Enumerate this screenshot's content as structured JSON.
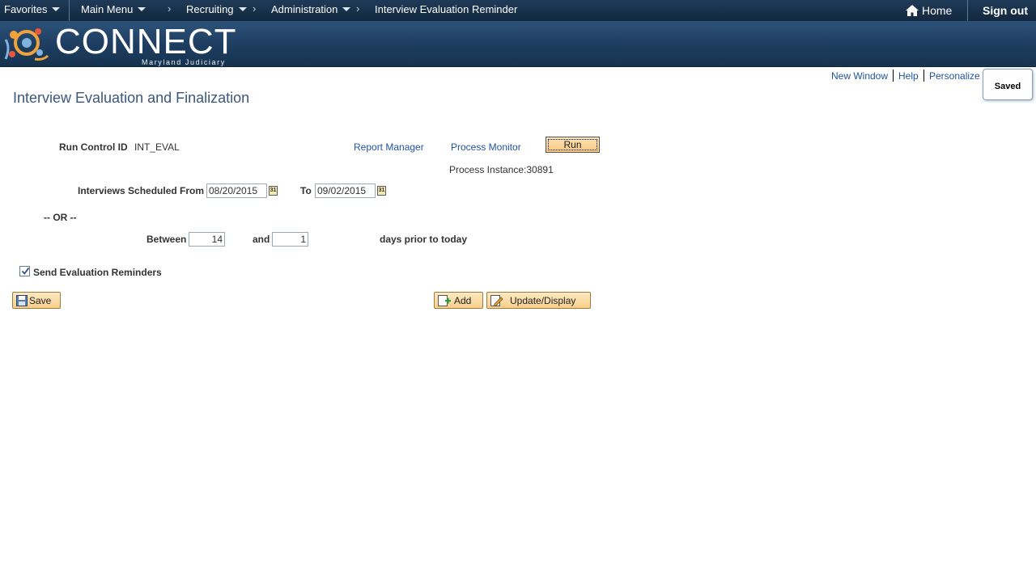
{
  "nav": {
    "favorites": "Favorites",
    "main_menu": "Main Menu",
    "breadcrumbs": [
      "Recruiting",
      "Administration",
      "Interview Evaluation Reminder"
    ],
    "home": "Home",
    "sign_out": "Sign out"
  },
  "banner": {
    "logo_text": "CONNECT",
    "logo_subtext": "Maryland Judiciary"
  },
  "page_links": {
    "new_window": "New Window",
    "help": "Help",
    "personalize": "Personalize",
    "saved_status": "Saved"
  },
  "page_title": "Interview Evaluation and Finalization",
  "run_control": {
    "label": "Run Control ID",
    "value": "INT_EVAL",
    "report_manager": "Report Manager",
    "process_monitor": "Process Monitor",
    "run_button": "Run",
    "process_instance": "Process Instance:30891"
  },
  "schedule": {
    "from_label": "Interviews Scheduled From",
    "from_value": "08/20/2015",
    "to_label": "To",
    "to_value": "09/02/2015",
    "calendar_glyph": "31",
    "or_label": "-- OR --",
    "between_label": "Between",
    "between_value": "14",
    "and_label": "and",
    "and_value": "1",
    "days_label": "days prior to today"
  },
  "reminders": {
    "checkbox_label": "Send Evaluation Reminders",
    "checked": true
  },
  "buttons": {
    "save": "Save",
    "add": "Add",
    "update_display": "Update/Display"
  },
  "colors": {
    "nav_bg": "#1f3a58",
    "banner_bg": "#1d3d60",
    "link": "#2352a3",
    "title": "#3b5780",
    "button_bg": "#f8cf8c"
  }
}
